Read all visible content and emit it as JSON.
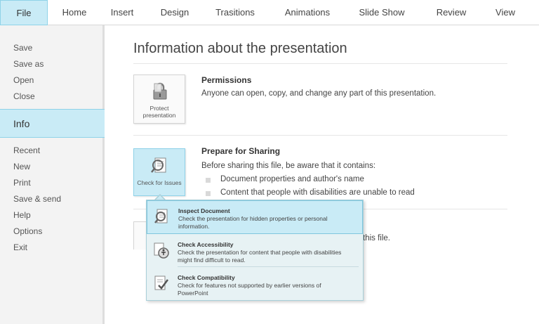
{
  "ribbon": {
    "tabs": [
      "File",
      "Home",
      "Insert",
      "Design",
      "Trasitions",
      "Animations",
      "Slide Show",
      "Review",
      "View"
    ]
  },
  "sidebar": {
    "items": [
      "Save",
      "Save as",
      "Open",
      "Close",
      "Info",
      "Recent",
      "New",
      "Print",
      "Save & send",
      "Help",
      "Options",
      "Exit"
    ],
    "selected": "Info"
  },
  "main": {
    "title": "Information about the presentation",
    "permissions": {
      "button_label": "Protect presentation",
      "title": "Permissions",
      "text": "Anyone can open, copy, and change any part of this presentation."
    },
    "sharing": {
      "button_label": "Check for Issues",
      "title": "Prepare for Sharing",
      "text": "Before sharing this file, be aware that it contains:",
      "bullets": [
        "Document properties and author's name",
        "Content that people with disabilities are unable to read"
      ]
    },
    "partial_text": "this file."
  },
  "dropdown": {
    "items": [
      {
        "title": "Inspect Document",
        "desc": "Check the presentation for hidden properties or personal information.",
        "icon": "inspect-document-icon"
      },
      {
        "title": "Check Accessibility",
        "desc": "Check the presentation for content that people with disabilities might find difficult to read.",
        "icon": "accessibility-icon"
      },
      {
        "title": "Check Compatibility",
        "desc": "Check for features not supported by earlier versions of PowerPoint",
        "icon": "compatibility-icon"
      }
    ]
  },
  "colors": {
    "accent": "#c9ebf6",
    "accent_border": "#8fd2e8",
    "sidebar_bg": "#f3f3f3"
  }
}
